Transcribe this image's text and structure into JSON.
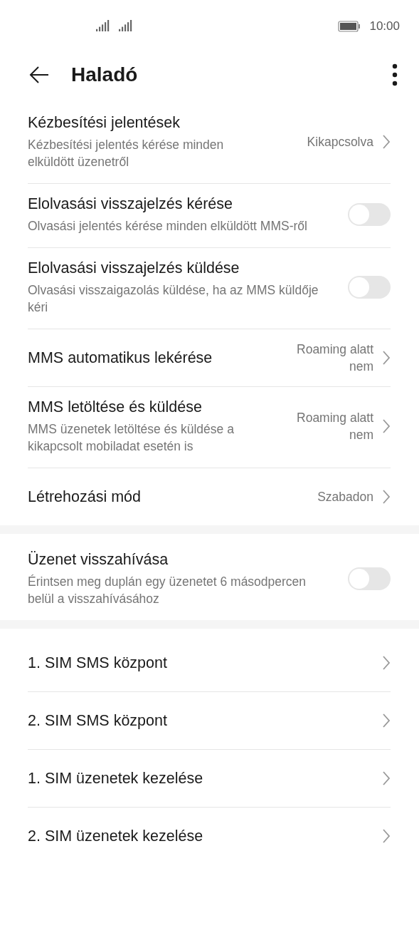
{
  "status_bar": {
    "time": "10:00"
  },
  "header": {
    "title": "Haladó"
  },
  "groups": [
    {
      "items": [
        {
          "kind": "link",
          "title": "Kézbesítési jelentések",
          "subtitle": "Kézbesítési jelentés kérése minden elküldött üzenetről",
          "value": "Kikapcsolva"
        },
        {
          "kind": "toggle",
          "title": "Elolvasási visszajelzés kérése",
          "subtitle": "Olvasási jelentés kérése minden elküldött MMS-ről",
          "on": false
        },
        {
          "kind": "toggle",
          "title": "Elolvasási visszajelzés küldése",
          "subtitle": "Olvasási visszaigazolás küldése, ha az MMS küldője kéri",
          "on": false
        },
        {
          "kind": "link",
          "title": "MMS automatikus lekérése",
          "value": "Roaming alatt nem"
        },
        {
          "kind": "link",
          "title": "MMS letöltése és küldése",
          "subtitle": "MMS üzenetek letöltése és küldése a kikapcsolt mobiladat esetén is",
          "value": "Roaming alatt nem"
        },
        {
          "kind": "link",
          "title": "Létrehozási mód",
          "value": "Szabadon"
        }
      ]
    },
    {
      "items": [
        {
          "kind": "toggle",
          "title": "Üzenet visszahívása",
          "subtitle": "Érintsen meg duplán egy üzenetet 6 másodpercen belül a visszahívásához",
          "on": false
        }
      ]
    },
    {
      "items": [
        {
          "kind": "link",
          "title": "1. SIM SMS központ"
        },
        {
          "kind": "link",
          "title": "2. SIM SMS központ"
        },
        {
          "kind": "link",
          "title": "1. SIM üzenetek kezelése"
        },
        {
          "kind": "link",
          "title": "2. SIM üzenetek kezelése"
        }
      ]
    }
  ]
}
